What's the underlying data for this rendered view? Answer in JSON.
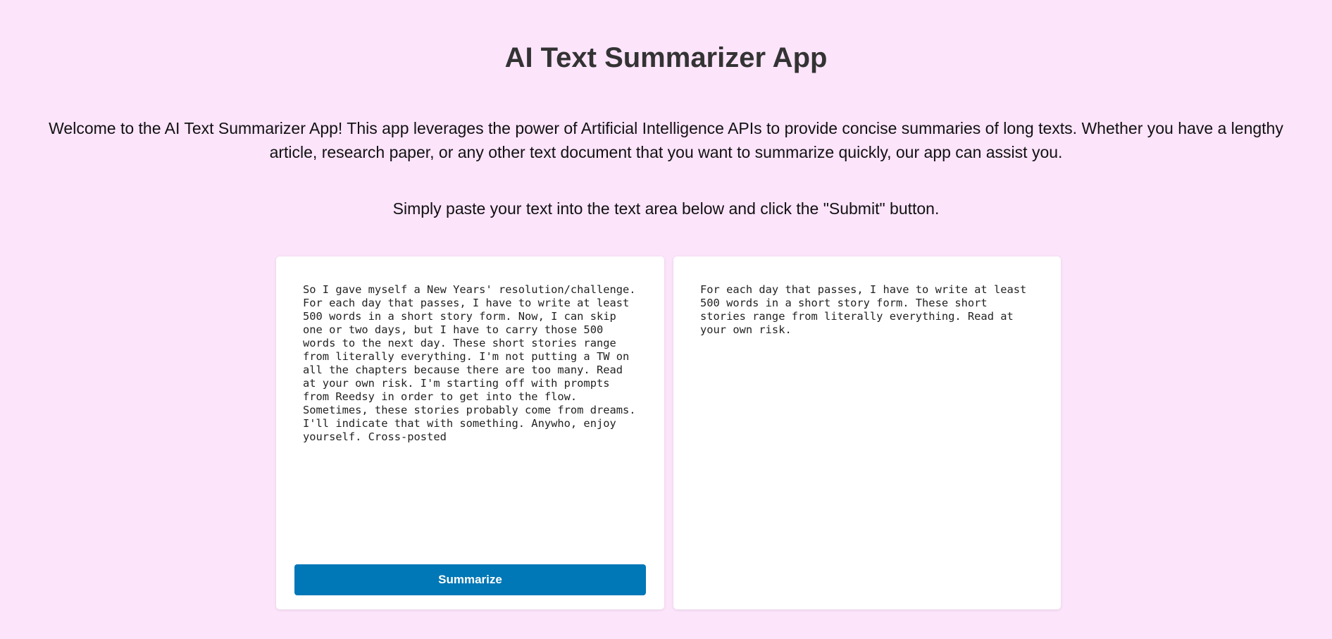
{
  "header": {
    "title": "AI Text Summarizer App"
  },
  "intro": {
    "text": "Welcome to the AI Text Summarizer App! This app leverages the power of Artificial Intelligence APIs to provide concise summaries of long texts. Whether you have a lengthy article, research paper, or any other text document that you want to summarize quickly, our app can assist you.",
    "instruction": "Simply paste your text into the text area below and click the \"Submit\" button."
  },
  "input": {
    "text": "So I gave myself a New Years' resolution/challenge. For each day that passes, I have to write at least 500 words in a short story form. Now, I can skip one or two days, but I have to carry those 500 words to the next day. These short stories range from literally everything. I'm not putting a TW on all the chapters because there are too many. Read at your own risk. I'm starting off with prompts from Reedsy in order to get into the flow. Sometimes, these stories probably come from dreams. I'll indicate that with something. Anywho, enjoy yourself. Cross-posted"
  },
  "actions": {
    "summarize_label": "Summarize"
  },
  "output": {
    "summary": "For each day that passes, I have to write at least 500 words in a short story form. These short stories range from literally everything. Read at your own risk."
  },
  "colors": {
    "background": "#fce4fb",
    "button": "#0077b6",
    "card": "#ffffff"
  }
}
